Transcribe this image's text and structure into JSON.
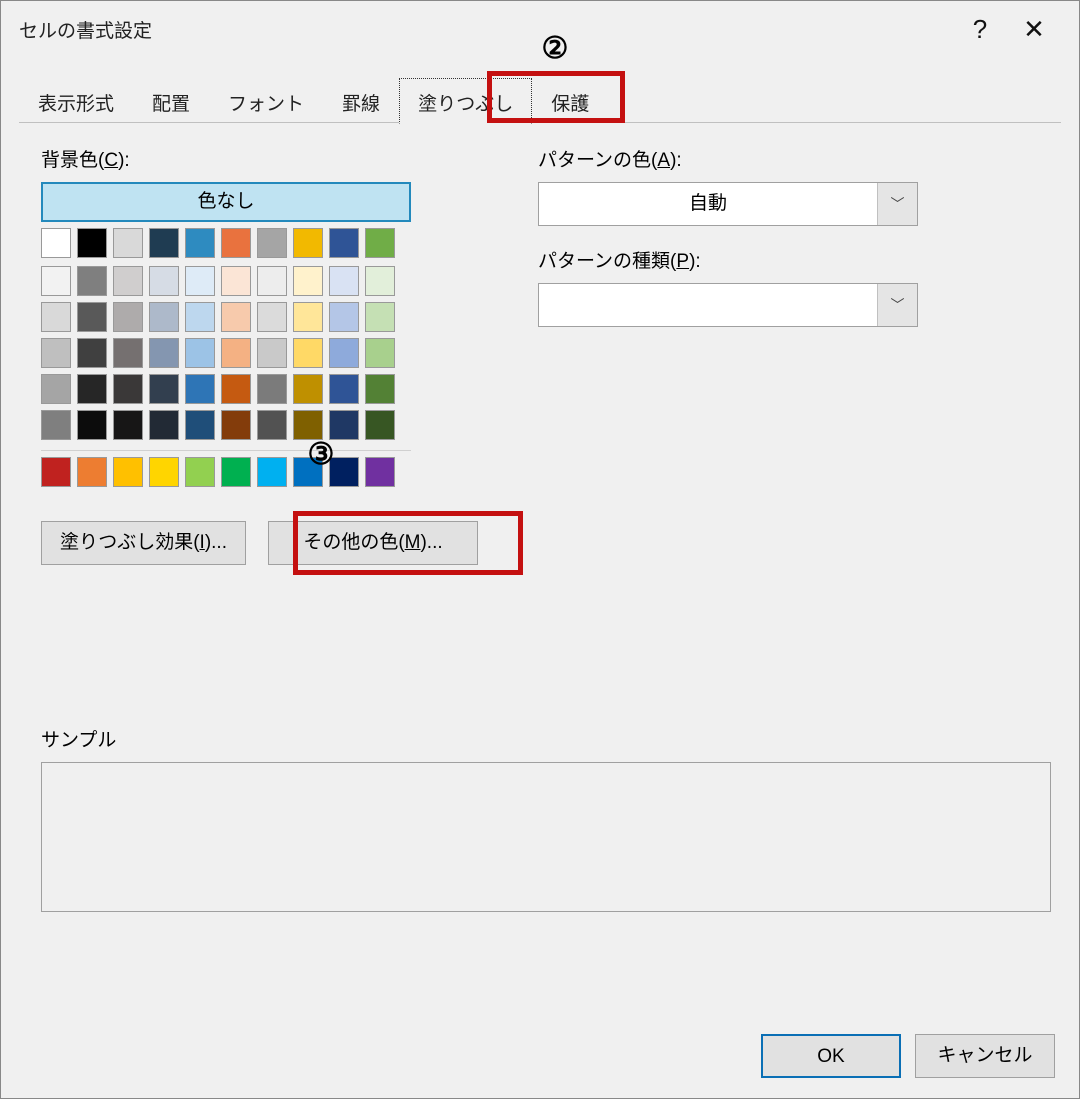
{
  "titlebar": {
    "title": "セルの書式設定",
    "help": "?",
    "close": "✕"
  },
  "tabs": {
    "items": [
      "表示形式",
      "配置",
      "フォント",
      "罫線",
      "塗りつぶし",
      "保護"
    ],
    "selected_index": 4
  },
  "left": {
    "bg_label_prefix": "背景色(",
    "bg_label_key": "C",
    "bg_label_suffix": "):",
    "no_color": "色なし",
    "row1": [
      "#ffffff",
      "#000000",
      "#d9d9d9",
      "#1f3c52",
      "#2e8bc0",
      "#e9723e",
      "#a5a5a5",
      "#f2b900",
      "#2f5496",
      "#70ad47"
    ],
    "grid": [
      [
        "#f2f2f2",
        "#7f7f7f",
        "#d0cece",
        "#d6dce5",
        "#deebf7",
        "#fbe5d6",
        "#ededed",
        "#fff2cc",
        "#d9e2f3",
        "#e2efda"
      ],
      [
        "#d9d9d9",
        "#595959",
        "#aeabab",
        "#adb9ca",
        "#bdd7ee",
        "#f7caac",
        "#dbdbdb",
        "#ffe699",
        "#b4c6e7",
        "#c5e0b4"
      ],
      [
        "#bfbfbf",
        "#404040",
        "#757070",
        "#8496b0",
        "#9cc3e6",
        "#f4b183",
        "#c9c9c9",
        "#ffd966",
        "#8eaadb",
        "#a8d08d"
      ],
      [
        "#a5a5a5",
        "#262626",
        "#3a3838",
        "#323f4f",
        "#2e75b6",
        "#c55a11",
        "#7b7b7b",
        "#bf9000",
        "#2f5496",
        "#538135"
      ],
      [
        "#7f7f7f",
        "#0c0c0c",
        "#171616",
        "#222a35",
        "#1f4e79",
        "#833c0b",
        "#525252",
        "#7f6000",
        "#1f3864",
        "#375623"
      ]
    ],
    "standard": [
      "#c0221f",
      "#ed7d31",
      "#ffc000",
      "#ffd500",
      "#92d050",
      "#00b050",
      "#00b0f0",
      "#0070c0",
      "#002060",
      "#7030a0"
    ],
    "fill_effects_prefix": "塗りつぶし効果(",
    "fill_effects_key": "I",
    "fill_effects_suffix": ")...",
    "more_colors_prefix": "その他の色(",
    "more_colors_key": "M",
    "more_colors_suffix": ")..."
  },
  "right": {
    "pattern_color_prefix": "パターンの色(",
    "pattern_color_key": "A",
    "pattern_color_suffix": "):",
    "pattern_color_value": "自動",
    "pattern_type_prefix": "パターンの種類(",
    "pattern_type_key": "P",
    "pattern_type_suffix": "):",
    "pattern_type_value": ""
  },
  "sample": {
    "label": "サンプル"
  },
  "footer": {
    "ok": "OK",
    "cancel": "キャンセル"
  },
  "callouts": {
    "c2": "②",
    "c3": "③"
  }
}
